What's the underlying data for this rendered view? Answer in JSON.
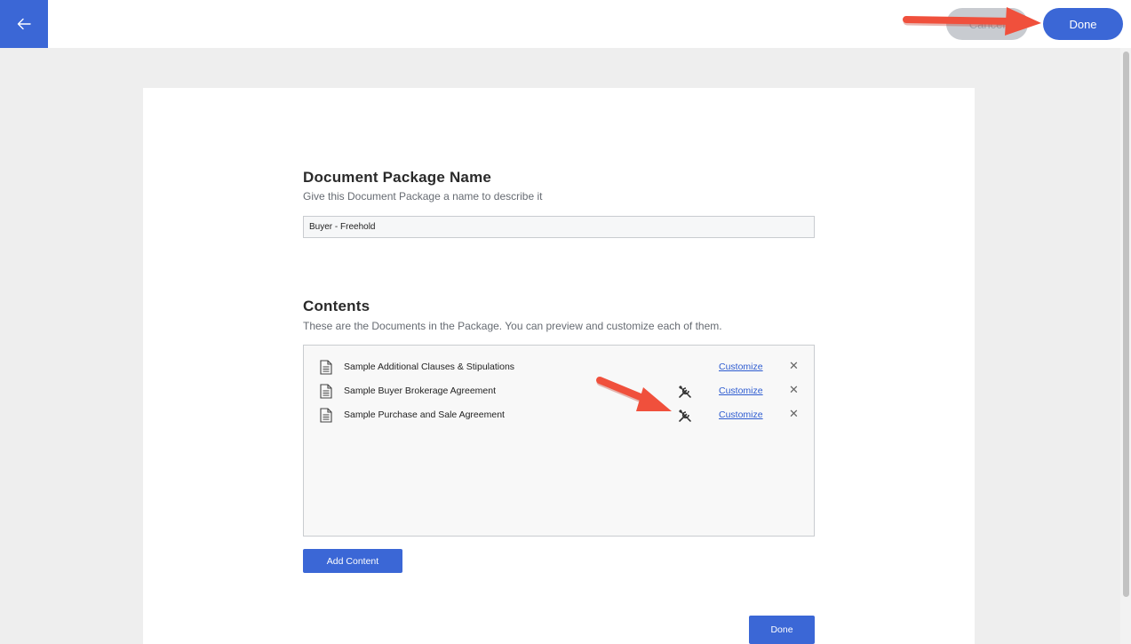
{
  "header": {
    "cancel_label": "Cancel",
    "done_label": "Done"
  },
  "package_name": {
    "title": "Document Package Name",
    "subtitle": "Give this Document Package a name to describe it",
    "value": "Buyer - Freehold"
  },
  "contents": {
    "title": "Contents",
    "subtitle": "These are the Documents in the Package. You can preview and customize each of them.",
    "documents": [
      {
        "name": "Sample Additional Clauses & Stipulations",
        "customize_label": "Customize",
        "customized": false
      },
      {
        "name": "Sample Buyer Brokerage Agreement",
        "customize_label": "Customize",
        "customized": true
      },
      {
        "name": "Sample Purchase and Sale Agreement",
        "customize_label": "Customize",
        "customized": true
      }
    ],
    "add_label": "Add Content"
  },
  "footer": {
    "done_label": "Done"
  },
  "colors": {
    "accent": "#3b67d6",
    "annotation_arrow": "#f0503c"
  }
}
